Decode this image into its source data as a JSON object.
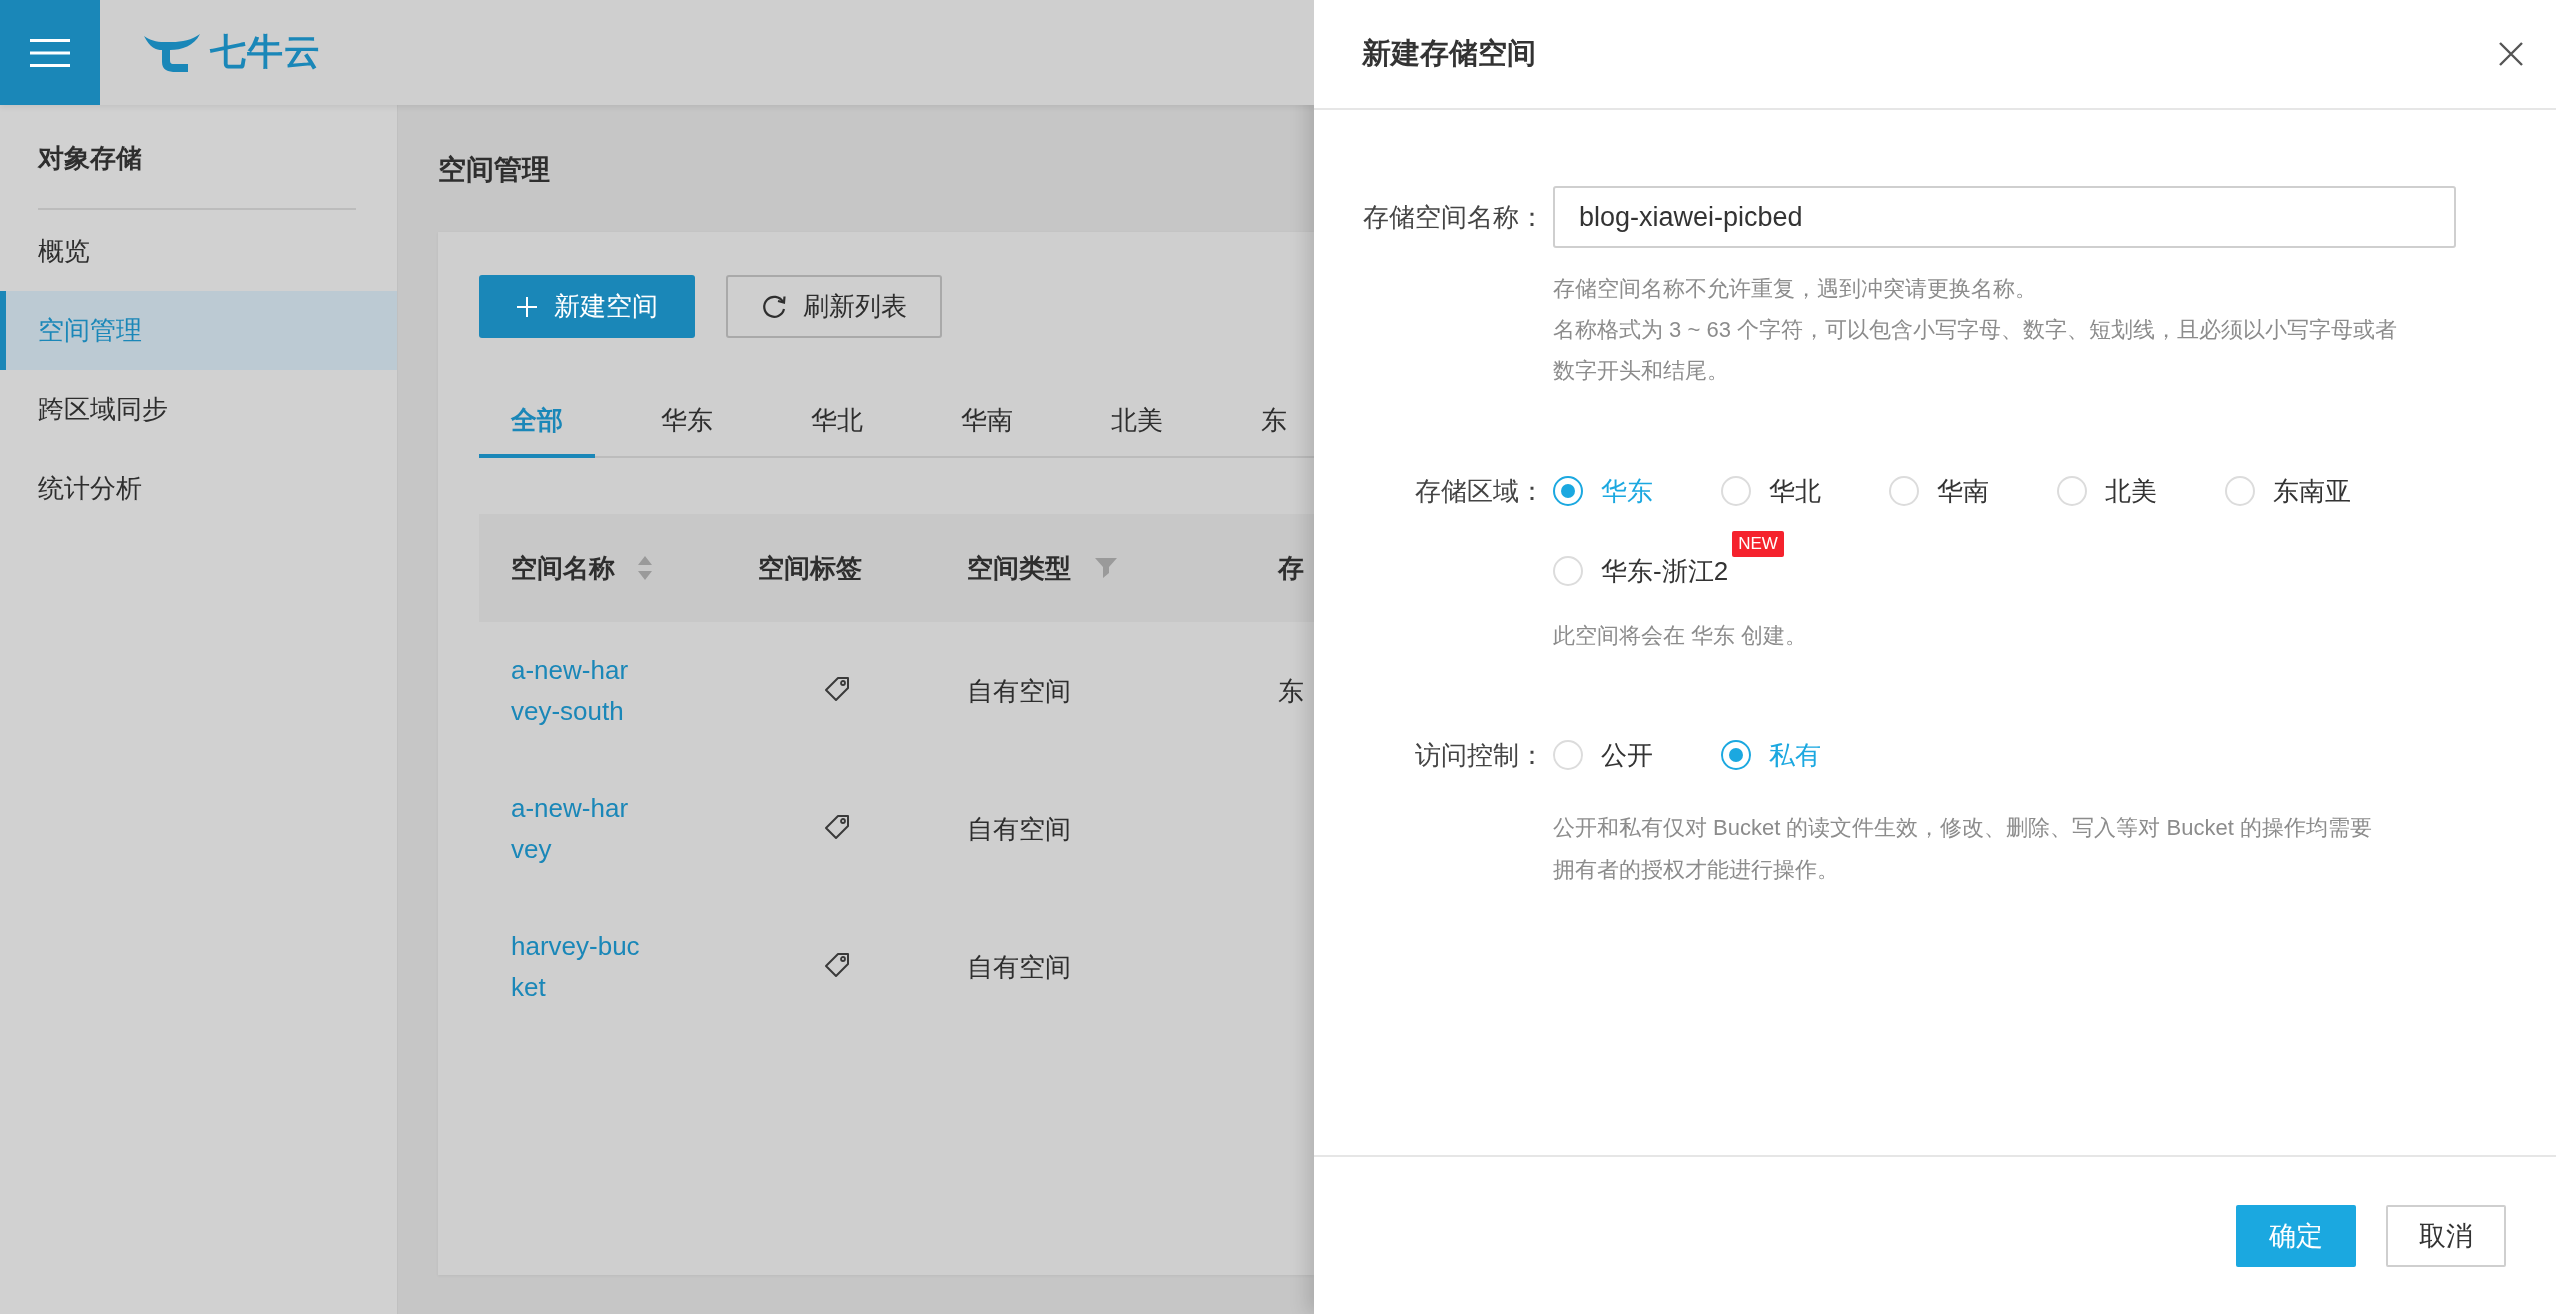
{
  "header": {
    "logo": "七牛云"
  },
  "sidebar": {
    "title": "对象存储",
    "items": [
      {
        "label": "概览",
        "selected": false
      },
      {
        "label": "空间管理",
        "selected": true
      },
      {
        "label": "跨区域同步",
        "selected": false
      },
      {
        "label": "统计分析",
        "selected": false
      }
    ]
  },
  "main": {
    "title": "空间管理",
    "buttons": [
      {
        "label": "新建空间",
        "kind": "add"
      },
      {
        "label": "刷新列表",
        "kind": "refresh"
      }
    ],
    "tabs": [
      {
        "label": "全部",
        "selected": true
      },
      {
        "label": "华东",
        "selected": false
      },
      {
        "label": "华北",
        "selected": false
      },
      {
        "label": "华南",
        "selected": false
      },
      {
        "label": "北美",
        "selected": false
      },
      {
        "label": "东",
        "selected": false
      }
    ],
    "table": {
      "columns": [
        {
          "label": "空间名称",
          "kind": "sort"
        },
        {
          "label": "空间标签",
          "kind": "plain"
        },
        {
          "label": "空间类型",
          "kind": "filter"
        },
        {
          "label": "存",
          "kind": "plain"
        }
      ],
      "rows": [
        {
          "name": "a-new-harvey-south",
          "type": "自有空间",
          "column_4": "东"
        },
        {
          "name": "a-new-harvey",
          "type": "自有空间"
        },
        {
          "name": "harvey-bucket",
          "type": "自有空间"
        }
      ]
    }
  },
  "modal": {
    "title": "新建存储空间",
    "name_field": {
      "label": "存储空间名称：",
      "value": "blog-xiawei-picbed",
      "hints": [
        "存储空间名称不允许重复，遇到冲突请更换名称。",
        "名称格式为 3 ~ 63 个字符，可以包含小写字母、数字、短划线，且必须以小写字母或者数字开头和结尾。"
      ]
    },
    "region": {
      "label": "存储区域：",
      "options": [
        {
          "label": "华东",
          "selected": true
        },
        {
          "label": "华北",
          "selected": false
        },
        {
          "label": "华南",
          "selected": false
        },
        {
          "label": "北美",
          "selected": false
        },
        {
          "label": "东南亚",
          "selected": false
        },
        {
          "label": "华东-浙江2",
          "selected": false,
          "badge": "NEW"
        }
      ],
      "note": "此空间将会在 华东 创建。"
    },
    "access": {
      "label": "访问控制：",
      "options": [
        {
          "label": "公开",
          "selected": false
        },
        {
          "label": "私有",
          "selected": true
        }
      ],
      "hint": "公开和私有仅对 Bucket 的读文件生效，修改、删除、写入等对 Bucket 的操作均需要拥有者的授权才能进行操作。"
    },
    "buttons": [
      {
        "label": "确定",
        "kind": "primary"
      },
      {
        "label": "取消",
        "kind": "default"
      }
    ]
  }
}
